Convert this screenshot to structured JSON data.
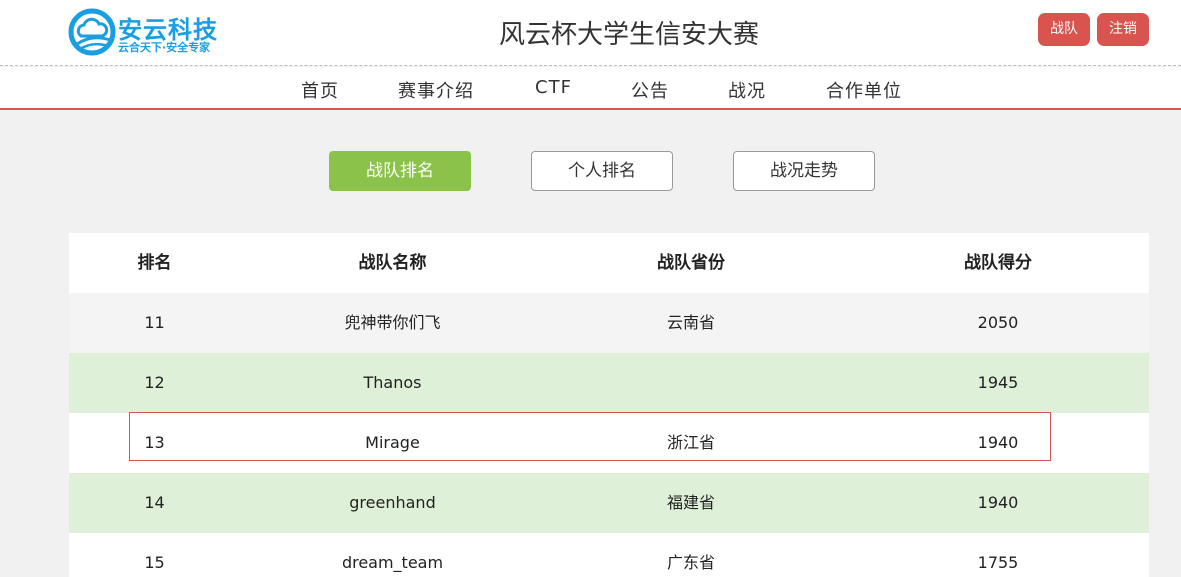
{
  "header": {
    "logo_name": "安云科技",
    "logo_slogan": "云合天下·安全专家",
    "site_title": "风云杯大学生信安大赛",
    "team_button": "战队",
    "logout_button": "注销"
  },
  "nav": [
    "首页",
    "赛事介绍",
    "CTF",
    "公告",
    "战况",
    "合作单位"
  ],
  "tabs": [
    "战队排名",
    "个人排名",
    "战况走势"
  ],
  "table": {
    "columns": [
      "排名",
      "战队名称",
      "战队省份",
      "战队得分"
    ],
    "rows": [
      [
        "11",
        "兜神带你们飞",
        "云南省",
        "2050"
      ],
      [
        "12",
        "Thanos",
        "",
        "1945"
      ],
      [
        "13",
        "Mirage",
        "浙江省",
        "1940"
      ],
      [
        "14",
        "greenhand",
        "福建省",
        "1940"
      ],
      [
        "15",
        "dream_team",
        "广东省",
        "1755"
      ]
    ]
  },
  "colors": {
    "accent_red": "#d9534f",
    "logo_blue": "#1a9ee2",
    "active_green": "#8bc34a",
    "row_green": "#dff0d8"
  },
  "icons": {
    "logo": "cloud-logo-icon"
  }
}
